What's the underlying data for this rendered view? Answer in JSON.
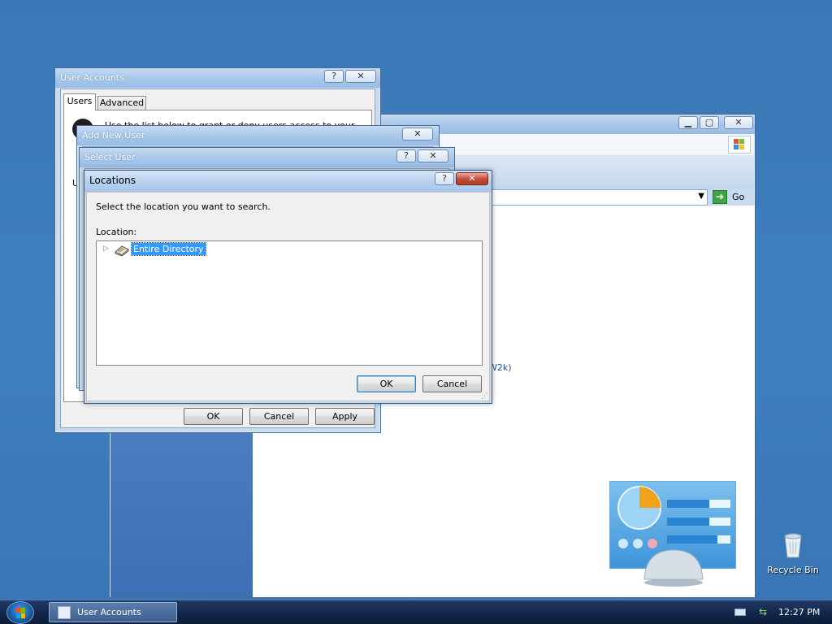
{
  "windows": {
    "background": {
      "go_label": "Go",
      "link_fragment": "W2k)"
    },
    "user_accounts": {
      "title": "User Accounts",
      "tabs": [
        "Users",
        "Advanced"
      ],
      "intro_text": "Use the list below to grant or deny users access to your",
      "label_u": "U",
      "ok_label": "OK",
      "cancel_label": "Cancel",
      "apply_label": "Apply"
    },
    "add_new_user": {
      "title": "Add New User"
    },
    "select_user": {
      "title": "Select User"
    },
    "locations": {
      "title": "Locations",
      "instruction": "Select the location you want to search.",
      "location_label": "Location:",
      "tree": [
        {
          "label": "Entire Directory",
          "selected": true
        }
      ],
      "ok_label": "OK",
      "cancel_label": "Cancel",
      "help_glyph": "?",
      "close_glyph": "✕"
    }
  },
  "desktop": {
    "recycle_bin_label": "Recycle Bin"
  },
  "taskbar": {
    "task_label": "User Accounts",
    "clock": "12:27 PM"
  },
  "colors": {
    "desktop": "#3b78b8",
    "selection": "#3399ff",
    "taskbar": "#14284b"
  }
}
